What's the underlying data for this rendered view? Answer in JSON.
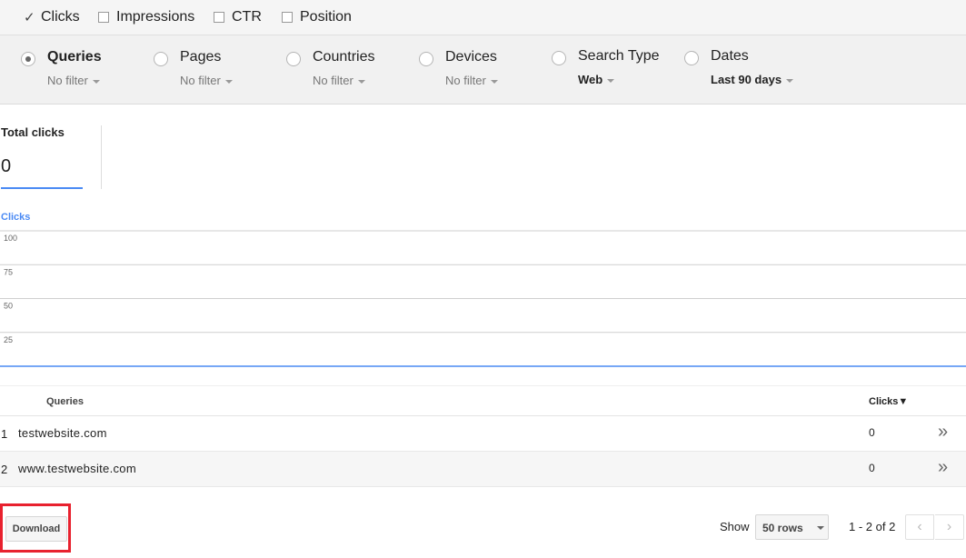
{
  "metrics": [
    {
      "label": "Clicks",
      "checked": true
    },
    {
      "label": "Impressions",
      "checked": false
    },
    {
      "label": "CTR",
      "checked": false
    },
    {
      "label": "Position",
      "checked": false
    }
  ],
  "filters": [
    {
      "label": "Queries",
      "sub": "No filter",
      "selected": true
    },
    {
      "label": "Pages",
      "sub": "No filter",
      "selected": false
    },
    {
      "label": "Countries",
      "sub": "No filter",
      "selected": false
    },
    {
      "label": "Devices",
      "sub": "No filter",
      "selected": false
    },
    {
      "label": "Search Type",
      "sub": "Web",
      "selected": false
    },
    {
      "label": "Dates",
      "sub": "Last 90 days",
      "selected": false
    }
  ],
  "totals": {
    "label": "Total clicks",
    "value": "0"
  },
  "chart_data": {
    "type": "line",
    "series_label": "Clicks",
    "yticks": [
      "100",
      "75",
      "50",
      "25"
    ],
    "ylim": [
      0,
      100
    ],
    "series": [
      {
        "name": "Clicks",
        "values": [
          0,
          0
        ]
      }
    ],
    "color": "#4a8af4"
  },
  "table": {
    "col_queries": "Queries",
    "col_clicks": "Clicks▼",
    "rows": [
      {
        "num": "1",
        "query": "testwebsite.com",
        "clicks": "0",
        "go": "»"
      },
      {
        "num": "2",
        "query": "www.testwebsite.com",
        "clicks": "0",
        "go": "»"
      }
    ]
  },
  "footer": {
    "download_label": "Download",
    "show_label": "Show",
    "rows_value": "50 rows",
    "page_info": "1 - 2 of 2",
    "prev": "‹",
    "next": "›"
  },
  "colors": {
    "accent": "#4a8af4",
    "highlight": "#e8212e"
  }
}
